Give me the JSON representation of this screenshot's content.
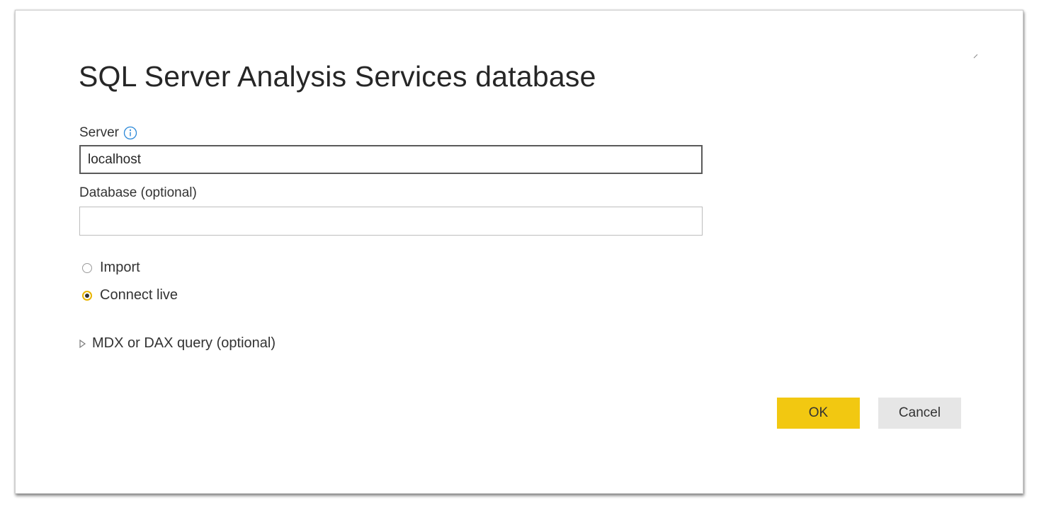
{
  "dialog": {
    "title": "SQL Server Analysis Services database",
    "close_icon": "close-icon"
  },
  "server": {
    "label": "Server",
    "info_icon": "info-icon",
    "value": "localhost"
  },
  "database": {
    "label": "Database (optional)",
    "value": ""
  },
  "connectivity_mode": {
    "options": [
      {
        "label": "Import",
        "selected": false
      },
      {
        "label": "Connect live",
        "selected": true
      }
    ]
  },
  "query_section": {
    "label": "MDX or DAX query (optional)",
    "expanded": false,
    "icon": "triangle-right-icon"
  },
  "buttons": {
    "ok_label": "OK",
    "cancel_label": "Cancel"
  },
  "colors": {
    "accent": "#f2c811",
    "radio_selected_ring": "#e8b400",
    "cancel_bg": "#e6e6e6",
    "text": "#333333"
  }
}
